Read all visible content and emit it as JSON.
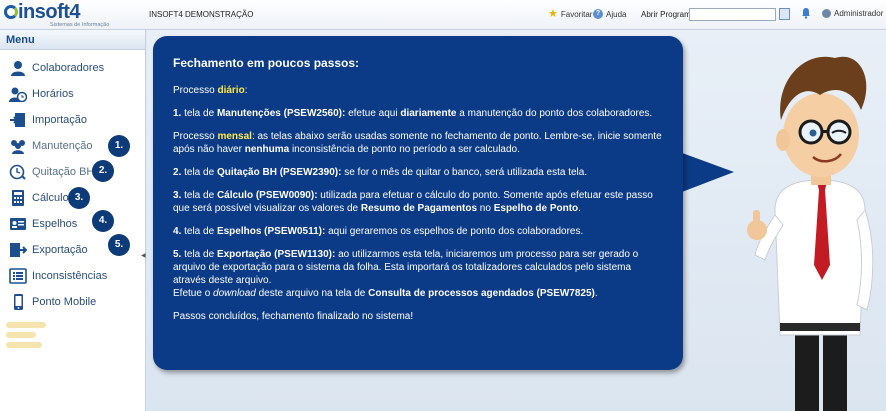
{
  "header": {
    "logo_text": "insoft4",
    "logo_sub": "Sistemas de Informação",
    "app_title": "INSOFT4 DEMONSTRAÇÃO",
    "favorites_label": "Favoritar",
    "help_label": "Ajuda",
    "program_label": "Abrir Programa:",
    "program_value": "",
    "user_label": "Administrador"
  },
  "sidebar": {
    "title": "Menu",
    "items": [
      {
        "label": "Colaboradores",
        "icon": "person-icon"
      },
      {
        "label": "Horários",
        "icon": "person-clock-icon"
      },
      {
        "label": "Importação",
        "icon": "import-icon"
      },
      {
        "label": "Manutenção",
        "icon": "group-icon",
        "step": "1."
      },
      {
        "label": "Quitação BH",
        "icon": "clock-icon",
        "step": "2."
      },
      {
        "label": "Cálculo",
        "icon": "calculator-icon",
        "step": "3."
      },
      {
        "label": "Espelhos",
        "icon": "id-card-icon",
        "step": "4."
      },
      {
        "label": "Exportação",
        "icon": "export-icon",
        "step": "5."
      },
      {
        "label": "Inconsistências",
        "icon": "list-icon"
      },
      {
        "label": "Ponto Mobile",
        "icon": "mobile-icon"
      }
    ]
  },
  "bubble": {
    "title": "Fechamento em poucos passos:",
    "intro_pre": "Processo ",
    "intro_hl": "diário",
    "intro_post": ":",
    "s1_num": "1.",
    "s1_a": " tela de ",
    "s1_b": "Manutenções (PSEW2560):",
    "s1_c": " efetue aqui ",
    "s1_d": "diariamente",
    "s1_e": " a manutenção do ponto dos colaboradores.",
    "m_pre": "Processo ",
    "m_hl": "mensal",
    "m_a": ": as telas abaixo serão usadas somente no fechamento de ponto. Lembre-se, inicie somente após não haver ",
    "m_b": "nenhuma",
    "m_c": " inconsistência de ponto no período a ser calculado.",
    "s2_num": "2.",
    "s2_a": " tela de ",
    "s2_b": "Quitação BH (PSEW2390):",
    "s2_c": " se for o mês de quitar o banco, será utilizada esta tela.",
    "s3_num": "3.",
    "s3_a": " tela de ",
    "s3_b": "Cálculo (PSEW0090):",
    "s3_c": " utilizada para efetuar o cálculo do ponto. Somente após efetuar este passo que será possível visualizar os valores de ",
    "s3_d": "Resumo de Pagamentos",
    "s3_e": " no ",
    "s3_f": "Espelho de Ponto",
    "s3_g": ".",
    "s4_num": "4.",
    "s4_a": " tela de ",
    "s4_b": "Espelhos (PSEW0511):",
    "s4_c": " aqui geraremos os espelhos de ponto dos colaboradores.",
    "s5_num": "5.",
    "s5_a": " tela de ",
    "s5_b": "Exportação (PSEW1130):",
    "s5_c": " ao utilizarmos esta tela, iniciaremos um processo para ser gerado o arquivo de exportação para o sistema da folha. Esta importará os totalizadores calculados pelo sistema através deste arquivo.",
    "s5_d": "Efetue o ",
    "s5_e": "download",
    "s5_f": " deste arquivo na tela de ",
    "s5_g": "Consulta de processos agendados (PSEW7825)",
    "s5_h": ".",
    "outro": "Passos concluídos, fechamento finalizado no sistema!"
  },
  "colors": {
    "bubble": "#0b3b86",
    "highlight": "#ffe94a",
    "badge": "#0d3a78",
    "menu_text": "#2a4d78"
  }
}
